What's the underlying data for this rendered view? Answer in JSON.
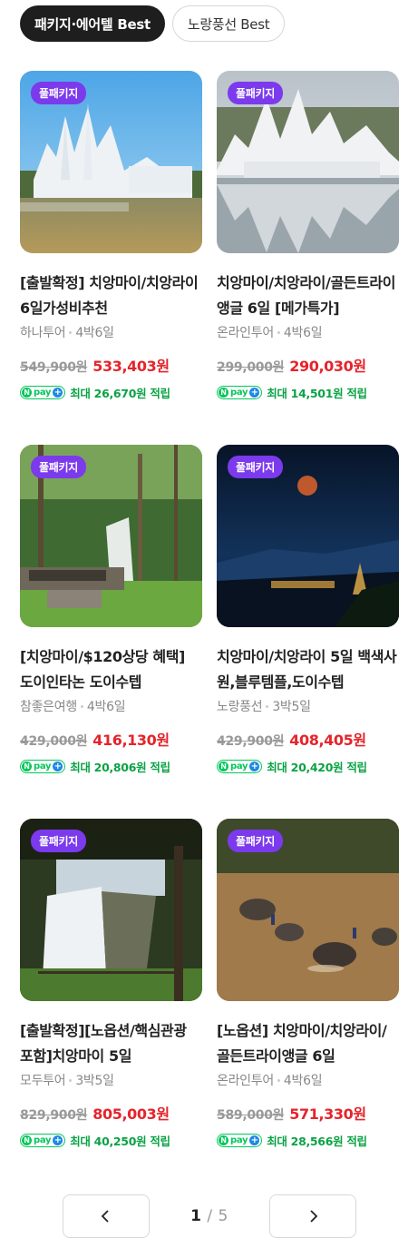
{
  "tabs": [
    {
      "label": "패키지·에어텔 Best",
      "active": true
    },
    {
      "label": "노랑풍선 Best",
      "active": false
    }
  ],
  "products": [
    {
      "badge": "풀패키지",
      "title": "[출발확정] 치앙마이/치앙라이 6일가성비추천",
      "agency": "하나투어",
      "duration": "4박6일",
      "original_price": "549,900원",
      "sale_price": "533,403원",
      "point_text": "최대 26,670원 적립"
    },
    {
      "badge": "풀패키지",
      "title": "치앙마이/치앙라이/골든트라이앵글 6일 [메가특가]",
      "agency": "온라인투어",
      "duration": "4박6일",
      "original_price": "299,000원",
      "sale_price": "290,030원",
      "point_text": "최대 14,501원 적립"
    },
    {
      "badge": "풀패키지",
      "title": "[치앙마이/$120상당 혜택] 도이인타논 도이수텝",
      "agency": "참좋은여행",
      "duration": "4박6일",
      "original_price": "429,000원",
      "sale_price": "416,130원",
      "point_text": "최대 20,806원 적립"
    },
    {
      "badge": "풀패키지",
      "title": "치앙마이/치앙라이 5일 백색사원,블루템플,도이수텝",
      "agency": "노랑풍선",
      "duration": "3박5일",
      "original_price": "429,900원",
      "sale_price": "408,405원",
      "point_text": "최대 20,420원 적립"
    },
    {
      "badge": "풀패키지",
      "title": "[출발확정][노옵션/핵심관광 포함]치앙마이 5일",
      "agency": "모두투어",
      "duration": "3박5일",
      "original_price": "829,900원",
      "sale_price": "805,003원",
      "point_text": "최대 40,250원 적립"
    },
    {
      "badge": "풀패키지",
      "title": "[노옵션] 치앙마이/치앙라이/골든트라이앵글 6일",
      "agency": "온라인투어",
      "duration": "4박6일",
      "original_price": "589,000원",
      "sale_price": "571,330원",
      "point_text": "최대 28,566원 적립"
    }
  ],
  "npay": {
    "n": "N",
    "pay": "pay",
    "plus": "+"
  },
  "pagination": {
    "current": "1",
    "separator": "/",
    "total": "5"
  },
  "colors": {
    "badge": "#7c3aed",
    "sale": "#e5242b",
    "point": "#0aa245",
    "npay": "#03c75a"
  },
  "icons": {
    "prev": "chevron-left-icon",
    "next": "chevron-right-icon"
  }
}
